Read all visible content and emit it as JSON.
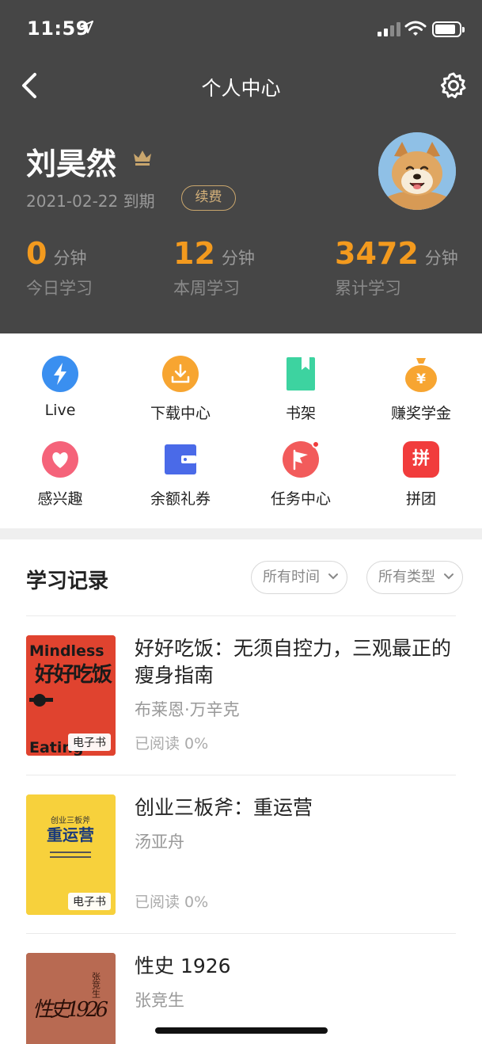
{
  "status_bar": {
    "time": "11:59"
  },
  "nav": {
    "title": "个人中心"
  },
  "profile": {
    "name": "刘昊然",
    "expiry": "2021-02-22 到期",
    "renew_label": "续费",
    "avatar": "shiba-dog-avatar"
  },
  "stats": [
    {
      "value": "0",
      "unit": "分钟",
      "label": "今日学习"
    },
    {
      "value": "12",
      "unit": "分钟",
      "label": "本周学习"
    },
    {
      "value": "3472",
      "unit": "分钟",
      "label": "累计学习"
    }
  ],
  "shortcuts": [
    {
      "label": "Live",
      "icon": "lightning-icon",
      "color": "#3a8ff0"
    },
    {
      "label": "下载中心",
      "icon": "download-icon",
      "color": "#f7a531"
    },
    {
      "label": "书架",
      "icon": "bookmark-book-icon",
      "color": "#3dd3a0"
    },
    {
      "label": "赚奖学金",
      "icon": "money-bag-icon",
      "color": "#f7a531"
    },
    {
      "label": "感兴趣",
      "icon": "heart-icon",
      "color": "#f5637a"
    },
    {
      "label": "余额礼券",
      "icon": "wallet-icon",
      "color": "#4a6ae8"
    },
    {
      "label": "任务中心",
      "icon": "flag-icon",
      "color": "#f25b5b"
    },
    {
      "label": "拼团",
      "icon": "pin-group-icon",
      "color": "#f13c3c",
      "glyph": "拼"
    }
  ],
  "records": {
    "title": "学习记录",
    "filter_time": "所有时间",
    "filter_type": "所有类型",
    "books": [
      {
        "title": "好好吃饭：无须自控力，三观最正的瘦身指南",
        "author": "布莱恩·万辛克",
        "progress": "已阅读 0%",
        "tag": "电子书",
        "cover": {
          "color": "#e0432f",
          "text": "好好吃饭",
          "top_text": "Mindless",
          "bottom_text": "Eating"
        }
      },
      {
        "title": "创业三板斧：重运营",
        "author": "汤亚舟",
        "progress": "已阅读 0%",
        "tag": "电子书",
        "cover": {
          "color": "#f7d13c",
          "text": "重运营",
          "top_text": "创业三板斧"
        }
      },
      {
        "title": "性史 1926",
        "author": "张竞生",
        "cover": {
          "color": "#b86a52",
          "text": "性史1926",
          "top_text": "张竞生"
        }
      }
    ]
  }
}
